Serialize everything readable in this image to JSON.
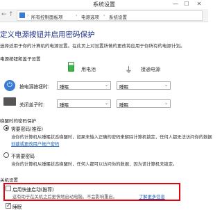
{
  "window": {
    "title": "系统设置",
    "min": "—",
    "max": "☐",
    "close": "✕"
  },
  "breadcrumb": [
    "所有控制面板项",
    "电源选项",
    "系统设置"
  ],
  "page": {
    "title": "定义电源按钮并启用密码保护",
    "description": "选择适用于你的计算机的电源设置。在此页上对设置所做的更改将应用于你所有的电源计划。"
  },
  "power_buttons": {
    "section_title": "电源按钮和盖子设置",
    "battery_label": "用电池",
    "plugged_label": "接通电源",
    "rows": [
      {
        "label": "按电源按钮时:",
        "battery": "睡眠",
        "plugged": "睡眠"
      },
      {
        "label": "关闭盖子时:",
        "battery": "睡眠",
        "plugged": "睡眠"
      }
    ]
  },
  "wake_password": {
    "section_title": "唤醒时的密码保护",
    "require": {
      "label": "需要密码(推荐)",
      "desc_line1": "当你的计算机从睡眠状态唤醒时，如果未输入正确的密码来解除计算机锁定，任何人都无法访问你的数据",
      "link": "创建或更改用户帐户密码"
    },
    "no_require": {
      "label": "不需要密码",
      "desc_line1": "当你的计算机从睡眠状态唤醒时，任何人都可以访问你的数据，因为该计算机未锁定。"
    }
  },
  "shutdown": {
    "section_title": "关机设置",
    "fast_startup": {
      "label": "启用快速启动(推荐)",
      "desc": "这有助于在关机之后更快地启动电脑。不会影响重启。",
      "link": "了解更多信息"
    },
    "sleep": {
      "label": "睡眠"
    }
  },
  "colors": {
    "title": "#1e3287",
    "link": "#1a5fb4",
    "highlight": "#e3000f"
  }
}
